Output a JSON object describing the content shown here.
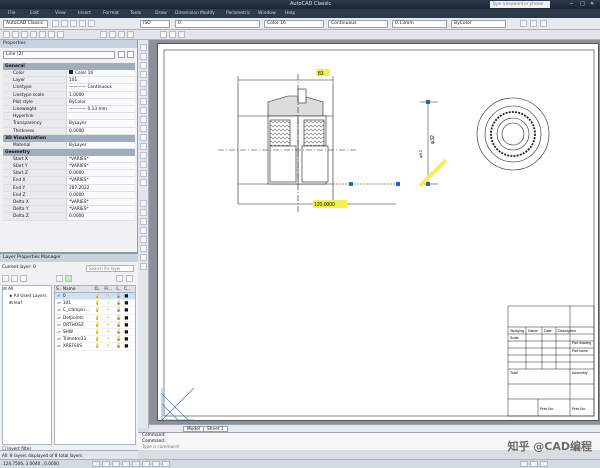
{
  "window": {
    "title": "AutoCAD Classic",
    "search_placeholder": "Type a keyword or phrase"
  },
  "menu": [
    "File",
    "Edit",
    "View",
    "Insert",
    "Format",
    "Tools",
    "Draw",
    "Dimension",
    "Modify",
    "Parametric",
    "Window",
    "Help"
  ],
  "toolbar": {
    "workspace": "AutoCAD Classic",
    "dimstyle": "ISO",
    "layer": "0",
    "color": "Color 16",
    "linetype": "Continuous",
    "lineweight": "0.13mm",
    "plotstyle": "ByColor"
  },
  "properties": {
    "panel_title": "Properties",
    "selection": "Line (2)",
    "categories": [
      {
        "name": "General",
        "rows": [
          {
            "k": "Color",
            "v": "Color 16"
          },
          {
            "k": "Layer",
            "v": "101"
          },
          {
            "k": "Linetype",
            "v": "———— Continuous"
          },
          {
            "k": "Linetype scale",
            "v": "1.0000"
          },
          {
            "k": "Plot style",
            "v": "ByColor"
          },
          {
            "k": "Lineweight",
            "v": "———— 0.13 mm"
          },
          {
            "k": "Hyperlink",
            "v": ""
          },
          {
            "k": "Transparency",
            "v": "ByLayer"
          },
          {
            "k": "Thickness",
            "v": "0.0000"
          }
        ]
      },
      {
        "name": "3D Visualization",
        "rows": [
          {
            "k": "Material",
            "v": "ByLayer"
          }
        ]
      },
      {
        "name": "Geometry",
        "rows": [
          {
            "k": "Start X",
            "v": "*VARIES*"
          },
          {
            "k": "Start Y",
            "v": "*VARIES*"
          },
          {
            "k": "Start Z",
            "v": "0.0000"
          },
          {
            "k": "End X",
            "v": "*VARIES*"
          },
          {
            "k": "End Y",
            "v": "287.2022"
          },
          {
            "k": "End Z",
            "v": "0.0000"
          },
          {
            "k": "Delta X",
            "v": "*VARIES*"
          },
          {
            "k": "Delta Y",
            "v": "*VARIES*"
          },
          {
            "k": "Delta Z",
            "v": "0.0000"
          }
        ]
      }
    ]
  },
  "layers": {
    "panel_title": "Layer Properties Manager",
    "current_layer": "Current layer: 0",
    "search_placeholder": "Search for layer",
    "filters": [
      "All",
      "All Used Layers",
      "leaf"
    ],
    "headers": {
      "s": "S..",
      "name": "Name",
      "on": "O..",
      "freeze": "Fr...",
      "lock": "L..",
      "color": "C.."
    },
    "rows": [
      {
        "name": "0",
        "sel": true
      },
      {
        "name": "101"
      },
      {
        "name": "C_clampin..."
      },
      {
        "name": "Defpoints"
      },
      {
        "name": "ORTHOSZ"
      },
      {
        "name": "SHW"
      },
      {
        "name": "Trimetro33"
      },
      {
        "name": "XREFS0S"
      }
    ],
    "invert_filter": "Invert filter",
    "status": "All: 8 layers displayed of 8 total layers"
  },
  "drawing": {
    "dim_top": "83",
    "dim_bottom": "120.0000",
    "dim_right": "φ32",
    "dim_right2": "φ5.2",
    "title_block": {
      "row1": [
        "Studying",
        "Name",
        "Date",
        "Description"
      ],
      "row2": "Scale",
      "total": "Total",
      "assembly": "Assembly",
      "label_a": "Part drawing",
      "label_b": "Part name",
      "bottom_a": "Print No.",
      "bottom_b": "Print No."
    }
  },
  "tabs": [
    "Model",
    "Sheet 1"
  ],
  "command": {
    "line1": "Command:",
    "line2": "Command:",
    "prompt": "Type a command"
  },
  "status": {
    "coords": "124.7506, 3.0040 , 0.0000"
  },
  "watermark": "知乎 @CAD编程"
}
